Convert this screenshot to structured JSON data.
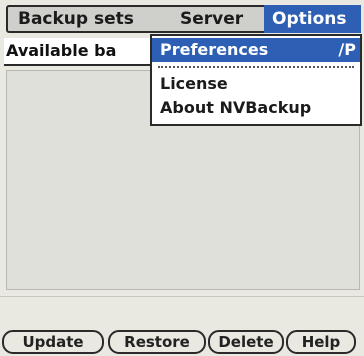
{
  "menubar": {
    "items": [
      {
        "label": "Backup sets"
      },
      {
        "label": "Server"
      },
      {
        "label": "Options"
      }
    ]
  },
  "form": {
    "title": "Available ba"
  },
  "options_menu": {
    "items": [
      {
        "label": "Preferences",
        "shortcut": "∕P"
      },
      {
        "label": "License"
      },
      {
        "label": "About NVBackup"
      }
    ]
  },
  "buttons": {
    "update": "Update",
    "restore": "Restore",
    "delete": "Delete",
    "help": "Help"
  },
  "colors": {
    "highlight": "#2d5fb4",
    "background": "#e9e8e1"
  }
}
